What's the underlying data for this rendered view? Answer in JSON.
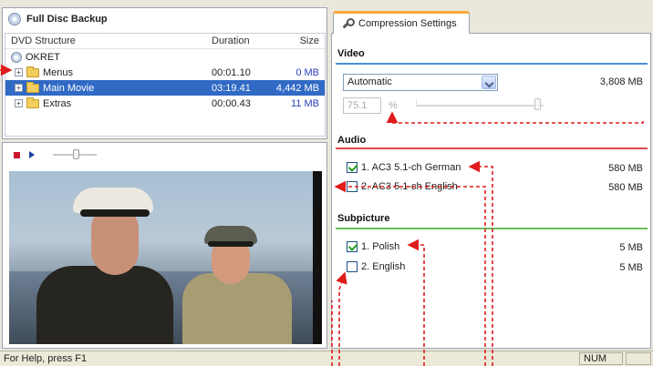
{
  "app": {
    "panel_title": "Full Disc Backup"
  },
  "tree": {
    "headers": {
      "name": "DVD Structure",
      "duration": "Duration",
      "size": "Size"
    },
    "root": "OKRET",
    "rows": [
      {
        "name": "Menus",
        "duration": "00:01.10",
        "size": "0 MB",
        "expander": "+"
      },
      {
        "name": "Main Movie",
        "duration": "03:19.41",
        "size": "4,442 MB",
        "expander": "+"
      },
      {
        "name": "Extras",
        "duration": "00:00.43",
        "size": "11 MB",
        "expander": "+"
      }
    ],
    "selected_row": "Main Movie"
  },
  "player": {
    "position_fraction": 0.5
  },
  "tabs": [
    {
      "label": "Compression Settings",
      "icon": "tool-icon"
    }
  ],
  "compression": {
    "video": {
      "title": "Video",
      "mode": "Automatic",
      "size": "3,808 MB",
      "quality_value": "75.1",
      "quality_unit": "%",
      "quality_fraction": 0.93
    },
    "audio": {
      "title": "Audio",
      "tracks": [
        {
          "label": "1. AC3 5.1-ch German",
          "size": "580 MB",
          "checked": true
        },
        {
          "label": "2. AC3 5.1-ch English",
          "size": "580 MB",
          "checked": false
        }
      ]
    },
    "subpicture": {
      "title": "Subpicture",
      "tracks": [
        {
          "label": "1. Polish",
          "size": "5 MB",
          "checked": true
        },
        {
          "label": "2. English",
          "size": "5 MB",
          "checked": false
        }
      ]
    }
  },
  "status_bar": {
    "help": "For Help, press F1",
    "num": "NUM"
  },
  "colors": {
    "selection": "#316ac5",
    "tab_accent": "#f7a93b",
    "video_line": "#4a90d9",
    "audio_line": "#d94a4a",
    "subpicture_line": "#6bbf59",
    "annotation": "#e01b1b"
  }
}
